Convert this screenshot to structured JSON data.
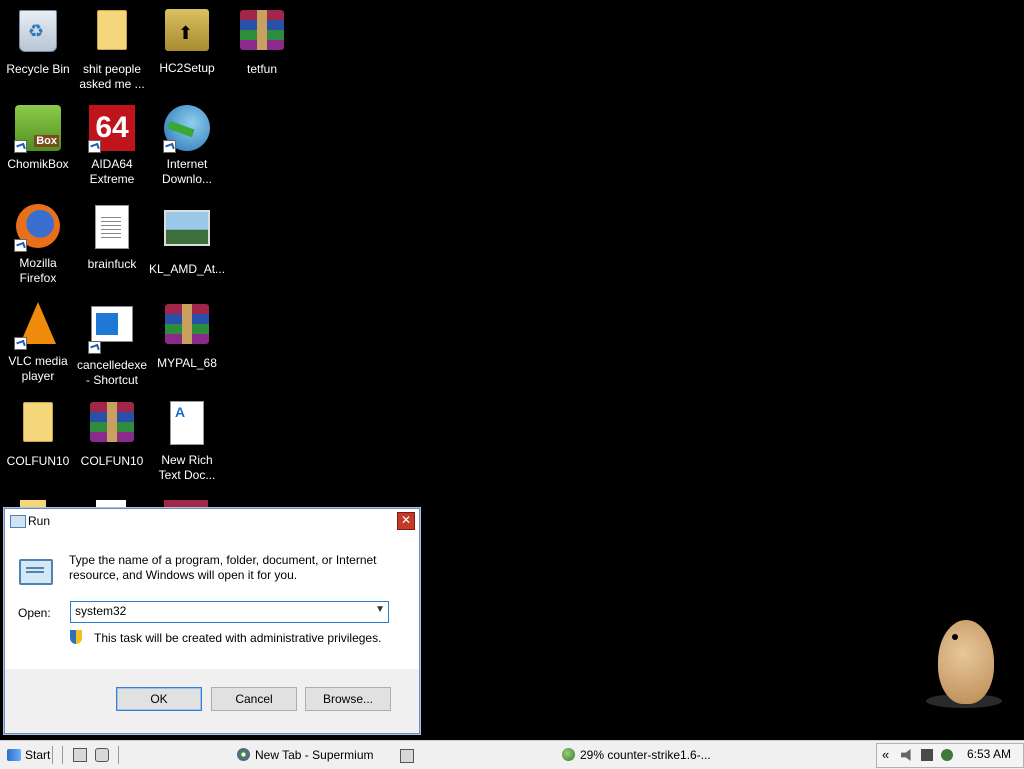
{
  "desktop": {
    "icons": [
      {
        "label": "Recycle Bin",
        "icon": "recycle-bin-icon"
      },
      {
        "label": "shit people asked me ...",
        "icon": "folder-icon"
      },
      {
        "label": "HC2Setup",
        "icon": "installer-box-icon"
      },
      {
        "label": "tetfun",
        "icon": "winrar-archive-icon"
      },
      {
        "label": "ChomikBox",
        "icon": "chomikbox-icon"
      },
      {
        "label": "AIDA64 Extreme",
        "icon": "aida64-icon"
      },
      {
        "label": "Internet Downlo...",
        "icon": "internet-download-manager-icon"
      },
      {
        "label": "Mozilla Firefox",
        "icon": "firefox-icon"
      },
      {
        "label": "brainfuck",
        "icon": "text-document-icon"
      },
      {
        "label": "KL_AMD_At...",
        "icon": "image-file-icon"
      },
      {
        "label": "VLC media player",
        "icon": "vlc-icon"
      },
      {
        "label": "cancelledexe - Shortcut",
        "icon": "window-shortcut-icon"
      },
      {
        "label": "MYPAL_68",
        "icon": "winrar-archive-icon"
      },
      {
        "label": "COLFUN10",
        "icon": "folder-icon"
      },
      {
        "label": "COLFUN10",
        "icon": "winrar-archive-icon"
      },
      {
        "label": "New Rich Text Doc...",
        "icon": "rich-text-document-icon"
      }
    ]
  },
  "run_dialog": {
    "title": "Run",
    "description": "Type the name of a program, folder, document, or Internet resource, and Windows will open it for you.",
    "open_label": "Open:",
    "open_value": "system32",
    "admin_note": "This task will be created with administrative privileges.",
    "buttons": {
      "ok": "OK",
      "cancel": "Cancel",
      "browse": "Browse..."
    }
  },
  "taskbar": {
    "start_label": "Start",
    "items": [
      {
        "label": "New Tab - Supermium",
        "icon": "supermium-browser-icon"
      },
      {
        "label": "29% counter-strike1.6-...",
        "icon": "download-globe-icon"
      }
    ],
    "tray": {
      "chevron": "«",
      "time": "6:53 AM"
    }
  },
  "colors": {
    "desktop_background": "#000000",
    "taskbar_background": "#f0f0f0",
    "close_button": "#c23a2a",
    "input_focus_border": "#2b7bd0"
  }
}
